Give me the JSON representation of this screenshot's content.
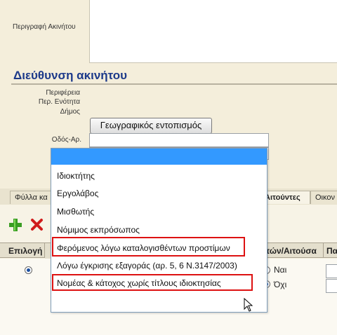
{
  "property": {
    "description_label": "Περιγραφή Ακινήτου"
  },
  "address_section": {
    "title": "Διεύθυνση ακινήτου",
    "region_label": "Περιφέρεια",
    "regional_unit_label": "Περ. Ενότητα",
    "municipality_label": "Δήμος",
    "geo_button": "Γεωγραφικός εντοπισμός",
    "street_label": "Οδός-Αρ."
  },
  "tabs": [
    {
      "label": "Φύλλα κα"
    },
    {
      "label": "Αιτούντες"
    },
    {
      "label": "Οικον"
    }
  ],
  "toolbar": {
    "add_icon": "plus-icon",
    "delete_icon": "x-icon"
  },
  "grid": {
    "col_select": "Επιλογή",
    "col_applicant": "πών/Αιτούσα",
    "col_next": "Πα",
    "radio_yes": "Ναι",
    "radio_no": "Όχι"
  },
  "dropdown": {
    "options": [
      "",
      "Ιδιοκτήτης",
      "Εργολάβος",
      "Μισθωτής",
      "Νόμιμος εκπρόσωπος",
      "Φερόμενος λόγω καταλογισθέντων προστίμων",
      "Λόγω έγκρισης εξαγοράς (αρ. 5, 6 Ν.3147/2003)",
      "Νομέας & κάτοχος χωρίς τίτλους ιδιοκτησίας"
    ],
    "highlight_color": "#3399ff",
    "annotation_color": "#dd1111"
  }
}
